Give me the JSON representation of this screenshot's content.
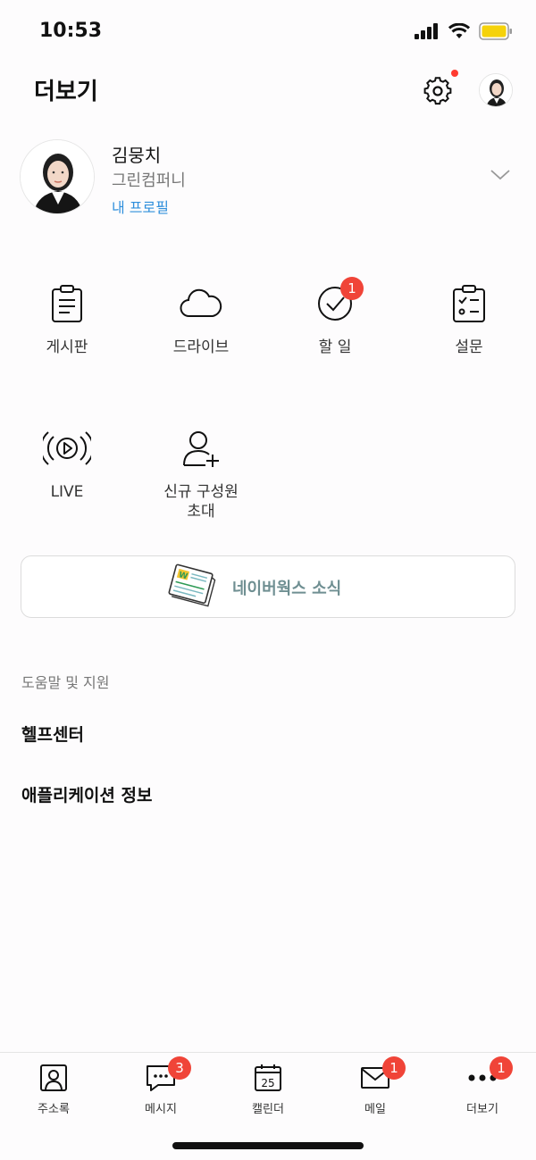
{
  "status_bar": {
    "time": "10:53",
    "battery_color": "#f5d20a"
  },
  "header": {
    "title": "더보기",
    "settings_icon": "gear-icon",
    "notification_dot_color": "#ff3b30"
  },
  "profile": {
    "name": "김뭉치",
    "company": "그린컴퍼니",
    "link_label": "내 프로필"
  },
  "menu": {
    "items": [
      {
        "label": "게시판",
        "icon": "board-icon"
      },
      {
        "label": "드라이브",
        "icon": "cloud-icon"
      },
      {
        "label": "할 일",
        "icon": "check-circle-icon",
        "badge": "1"
      },
      {
        "label": "설문",
        "icon": "survey-icon"
      },
      {
        "label": "LIVE",
        "icon": "live-icon"
      },
      {
        "label": "신규 구성원\n초대",
        "icon": "add-user-icon"
      }
    ]
  },
  "news_banner": {
    "label": "네이버웍스 소식",
    "icon": "newspaper-icon"
  },
  "help": {
    "section_title": "도움말 및 지원",
    "items": [
      "헬프센터",
      "애플리케이션 정보"
    ]
  },
  "tabbar": {
    "tabs": [
      {
        "label": "주소록",
        "icon": "contacts-icon"
      },
      {
        "label": "메시지",
        "icon": "message-icon",
        "badge": "3"
      },
      {
        "label": "캘린더",
        "icon": "calendar-icon",
        "calendar_day": "25"
      },
      {
        "label": "메일",
        "icon": "mail-icon",
        "badge": "1"
      },
      {
        "label": "더보기",
        "icon": "more-icon",
        "badge": "1"
      }
    ]
  },
  "colors": {
    "badge": "#f04438",
    "link": "#2f8fdc",
    "news_text": "#6f8f92"
  }
}
